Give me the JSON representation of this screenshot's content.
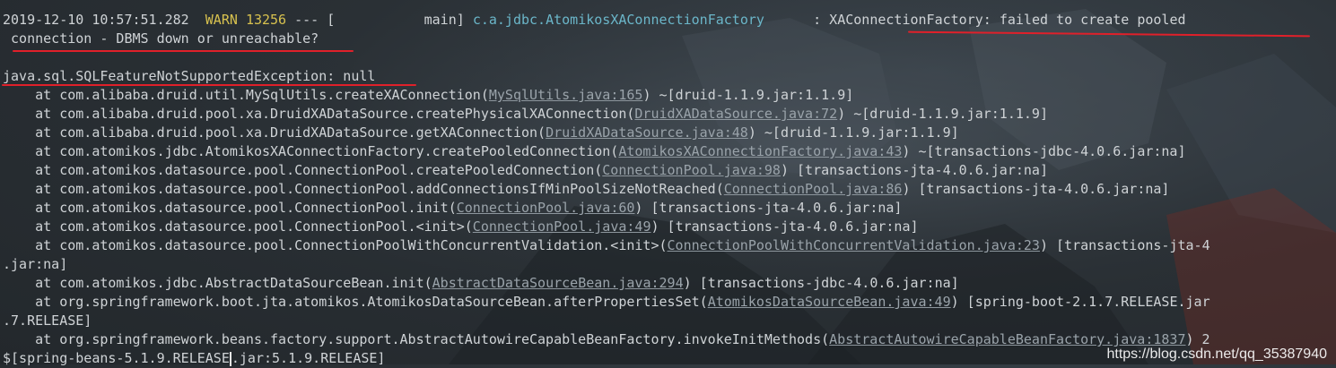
{
  "log_header": {
    "timestamp": "2019-12-10 10:57:51.282",
    "level": "WARN",
    "pid": "13256",
    "separator": "--- [",
    "thread": "           main]",
    "logger": "c.a.jdbc.AtomikosXAConnectionFactory",
    "colon": ":",
    "message_part1": "XAConnectionFactory: failed to create pooled",
    "message_part2": "connection - DBMS down or unreachable?"
  },
  "exception": "java.sql.SQLFeatureNotSupportedException: null",
  "stack": [
    {
      "prefix": "    at com.alibaba.druid.util.MySqlUtils.createXAConnection(",
      "link": "MySqlUtils.java:165",
      "suffix": ") ~[druid-1.1.9.jar:1.1.9]"
    },
    {
      "prefix": "    at com.alibaba.druid.pool.xa.DruidXADataSource.createPhysicalXAConnection(",
      "link": "DruidXADataSource.java:72",
      "suffix": ") ~[druid-1.1.9.jar:1.1.9]"
    },
    {
      "prefix": "    at com.alibaba.druid.pool.xa.DruidXADataSource.getXAConnection(",
      "link": "DruidXADataSource.java:48",
      "suffix": ") ~[druid-1.1.9.jar:1.1.9]"
    },
    {
      "prefix": "    at com.atomikos.jdbc.AtomikosXAConnectionFactory.createPooledConnection(",
      "link": "AtomikosXAConnectionFactory.java:43",
      "suffix": ") ~[transactions-jdbc-4.0.6.jar:na]"
    },
    {
      "prefix": "    at com.atomikos.datasource.pool.ConnectionPool.createPooledConnection(",
      "link": "ConnectionPool.java:98",
      "suffix": ") [transactions-jta-4.0.6.jar:na]"
    },
    {
      "prefix": "    at com.atomikos.datasource.pool.ConnectionPool.addConnectionsIfMinPoolSizeNotReached(",
      "link": "ConnectionPool.java:86",
      "suffix": ") [transactions-jta-4.0.6.jar:na]"
    },
    {
      "prefix": "    at com.atomikos.datasource.pool.ConnectionPool.init(",
      "link": "ConnectionPool.java:60",
      "suffix": ") [transactions-jta-4.0.6.jar:na]"
    },
    {
      "prefix": "    at com.atomikos.datasource.pool.ConnectionPool.<init>(",
      "link": "ConnectionPool.java:49",
      "suffix": ") [transactions-jta-4.0.6.jar:na]"
    },
    {
      "prefix": "    at com.atomikos.datasource.pool.ConnectionPoolWithConcurrentValidation.<init>(",
      "link": "ConnectionPoolWithConcurrentValidation.java:23",
      "suffix": ") [transactions-jta-4"
    },
    {
      "prefix": ".jar:na]",
      "link": "",
      "suffix": ""
    },
    {
      "prefix": "    at com.atomikos.jdbc.AbstractDataSourceBean.init(",
      "link": "AbstractDataSourceBean.java:294",
      "suffix": ") [transactions-jdbc-4.0.6.jar:na]"
    },
    {
      "prefix": "    at org.springframework.boot.jta.atomikos.AtomikosDataSourceBean.afterPropertiesSet(",
      "link": "AtomikosDataSourceBean.java:49",
      "suffix": ") [spring-boot-2.1.7.RELEASE.jar"
    },
    {
      "prefix": ".7.RELEASE]",
      "link": "",
      "suffix": ""
    },
    {
      "prefix": "    at org.springframework.beans.factory.support.AbstractAutowireCapableBeanFactory.invokeInitMethods(",
      "link": "AbstractAutowireCapableBeanFactory.java:1837",
      "suffix": ") 2"
    }
  ],
  "last_line": {
    "before_cursor": "$[spring-beans-5.1.9.RELEASE",
    "after_cursor": ".jar:5.1.9.RELEASE]"
  },
  "watermark": "https://blog.csdn.net/qq_35387940",
  "colors": {
    "warn": "#d7c14f",
    "logger": "#6bb6c9",
    "highlight_underline": "#e0202a"
  }
}
